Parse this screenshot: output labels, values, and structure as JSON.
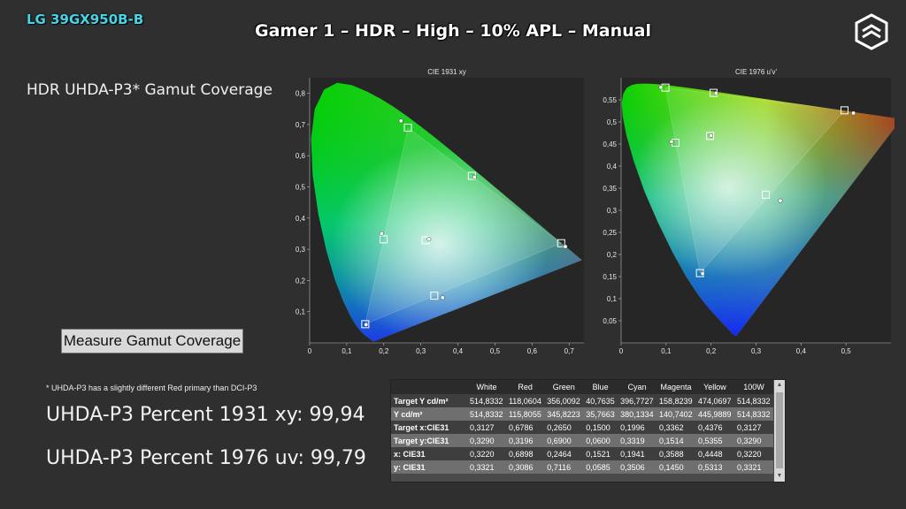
{
  "header": {
    "model": "LG 39GX950B-B",
    "title": "Gamer 1 – HDR – High – 10% APL – Manual"
  },
  "gamut_heading": "HDR UHDA-P3* Gamut Coverage",
  "measure_button": "Measure Gamut Coverage",
  "footnote": "* UHDA-P3 has a slightly different Red primary than DCI-P3",
  "results": {
    "xy_percent": "UHDA-P3 Percent 1931 xy: 99,94",
    "uv_percent": "UHDA-P3 Percent 1976 uv: 99,79"
  },
  "table": {
    "columns": [
      "",
      "White",
      "Red",
      "Green",
      "Blue",
      "Cyan",
      "Magenta",
      "Yellow",
      "100W"
    ],
    "rows": [
      {
        "label": "Target Y cd/m²",
        "cells": [
          "514,8332",
          "118,0604",
          "356,0092",
          "40,7635",
          "396,7727",
          "158,8239",
          "474,0697",
          "514,8332"
        ]
      },
      {
        "label": "Y cd/m²",
        "cells": [
          "514,8332",
          "115,8055",
          "345,8223",
          "35,7663",
          "380,1334",
          "140,7402",
          "445,9889",
          "514,8332"
        ]
      },
      {
        "label": "Target x:CIE31",
        "cells": [
          "0,3127",
          "0,6786",
          "0,2650",
          "0,1500",
          "0,1996",
          "0,3362",
          "0,4376",
          "0,3127"
        ]
      },
      {
        "label": "Target y:CIE31",
        "cells": [
          "0,3290",
          "0,3196",
          "0,6900",
          "0,0600",
          "0,3319",
          "0,1514",
          "0,5355",
          "0,3290"
        ]
      },
      {
        "label": "x: CIE31",
        "cells": [
          "0,3220",
          "0,6898",
          "0,2464",
          "0,1521",
          "0,1941",
          "0,3588",
          "0,4448",
          "0,3220"
        ]
      },
      {
        "label": "y: CIE31",
        "cells": [
          "0,3321",
          "0,3086",
          "0,7116",
          "0,0585",
          "0,3506",
          "0,1450",
          "0,5313",
          "0,3321"
        ]
      }
    ]
  },
  "chart_data": [
    {
      "type": "scatter",
      "title": "CIE 1931 xy",
      "xlim": [
        0,
        0.74
      ],
      "ylim": [
        0,
        0.85
      ],
      "xticks": [
        "0",
        "0,1",
        "0,2",
        "0,3",
        "0,4",
        "0,5",
        "0,6",
        "0,7"
      ],
      "yticks": [
        "0,1",
        "0,2",
        "0,3",
        "0,4",
        "0,5",
        "0,6",
        "0,7",
        "0,8"
      ],
      "series": [
        {
          "values": [
            [
              0.3127,
              0.329
            ],
            [
              0.6786,
              0.3196
            ],
            [
              0.265,
              0.69
            ],
            [
              0.15,
              0.06
            ],
            [
              0.1996,
              0.3319
            ],
            [
              0.3362,
              0.1514
            ],
            [
              0.4376,
              0.5355
            ]
          ]
        },
        {
          "values": [
            [
              0.322,
              0.3321
            ],
            [
              0.6898,
              0.3086
            ],
            [
              0.2464,
              0.7116
            ],
            [
              0.1521,
              0.0585
            ],
            [
              0.1941,
              0.3506
            ],
            [
              0.3588,
              0.145
            ],
            [
              0.4448,
              0.5313
            ]
          ]
        }
      ]
    },
    {
      "type": "scatter",
      "title": "CIE 1976 u'v'",
      "xlim": [
        0,
        0.6
      ],
      "ylim": [
        0,
        0.6
      ],
      "xticks": [
        "0",
        "0,1",
        "0,2",
        "0,3",
        "0,4",
        "0,5"
      ],
      "yticks": [
        "0,05",
        "0,1",
        "0,15",
        "0,2",
        "0,25",
        "0,3",
        "0,35",
        "0,4",
        "0,45",
        "0,5",
        "0,55"
      ],
      "series": [
        {
          "values": [
            [
              0.1978,
              0.4683
            ],
            [
              0.4967,
              0.5263
            ],
            [
              0.0986,
              0.5777
            ],
            [
              0.1754,
              0.1579
            ],
            [
              0.121,
              0.453
            ],
            [
              0.3217,
              0.3354
            ],
            [
              0.2055,
              0.5658
            ]
          ]
        },
        {
          "values": [
            [
              0.1999,
              0.4694
            ],
            [
              0.5166,
              0.52
            ],
            [
              0.0882,
              0.5784
            ],
            [
              0.1812,
              0.1568
            ],
            [
              0.1121,
              0.4555
            ],
            [
              0.3541,
              0.3218
            ],
            [
              0.2109,
              0.565
            ]
          ]
        }
      ]
    }
  ],
  "colors": {
    "accent": "#46d4e6",
    "background": "#2f2f2f",
    "plot_bg": "#262626"
  }
}
